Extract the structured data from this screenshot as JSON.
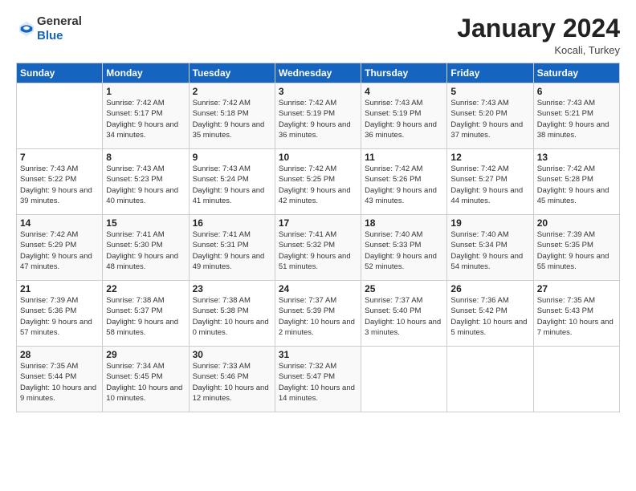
{
  "header": {
    "logo_general": "General",
    "logo_blue": "Blue",
    "month_title": "January 2024",
    "location": "Kocali, Turkey"
  },
  "weekdays": [
    "Sunday",
    "Monday",
    "Tuesday",
    "Wednesday",
    "Thursday",
    "Friday",
    "Saturday"
  ],
  "weeks": [
    [
      {
        "day": "",
        "sunrise": "",
        "sunset": "",
        "daylight": ""
      },
      {
        "day": "1",
        "sunrise": "Sunrise: 7:42 AM",
        "sunset": "Sunset: 5:17 PM",
        "daylight": "Daylight: 9 hours and 34 minutes."
      },
      {
        "day": "2",
        "sunrise": "Sunrise: 7:42 AM",
        "sunset": "Sunset: 5:18 PM",
        "daylight": "Daylight: 9 hours and 35 minutes."
      },
      {
        "day": "3",
        "sunrise": "Sunrise: 7:42 AM",
        "sunset": "Sunset: 5:19 PM",
        "daylight": "Daylight: 9 hours and 36 minutes."
      },
      {
        "day": "4",
        "sunrise": "Sunrise: 7:43 AM",
        "sunset": "Sunset: 5:19 PM",
        "daylight": "Daylight: 9 hours and 36 minutes."
      },
      {
        "day": "5",
        "sunrise": "Sunrise: 7:43 AM",
        "sunset": "Sunset: 5:20 PM",
        "daylight": "Daylight: 9 hours and 37 minutes."
      },
      {
        "day": "6",
        "sunrise": "Sunrise: 7:43 AM",
        "sunset": "Sunset: 5:21 PM",
        "daylight": "Daylight: 9 hours and 38 minutes."
      }
    ],
    [
      {
        "day": "7",
        "sunrise": "Sunrise: 7:43 AM",
        "sunset": "Sunset: 5:22 PM",
        "daylight": "Daylight: 9 hours and 39 minutes."
      },
      {
        "day": "8",
        "sunrise": "Sunrise: 7:43 AM",
        "sunset": "Sunset: 5:23 PM",
        "daylight": "Daylight: 9 hours and 40 minutes."
      },
      {
        "day": "9",
        "sunrise": "Sunrise: 7:43 AM",
        "sunset": "Sunset: 5:24 PM",
        "daylight": "Daylight: 9 hours and 41 minutes."
      },
      {
        "day": "10",
        "sunrise": "Sunrise: 7:42 AM",
        "sunset": "Sunset: 5:25 PM",
        "daylight": "Daylight: 9 hours and 42 minutes."
      },
      {
        "day": "11",
        "sunrise": "Sunrise: 7:42 AM",
        "sunset": "Sunset: 5:26 PM",
        "daylight": "Daylight: 9 hours and 43 minutes."
      },
      {
        "day": "12",
        "sunrise": "Sunrise: 7:42 AM",
        "sunset": "Sunset: 5:27 PM",
        "daylight": "Daylight: 9 hours and 44 minutes."
      },
      {
        "day": "13",
        "sunrise": "Sunrise: 7:42 AM",
        "sunset": "Sunset: 5:28 PM",
        "daylight": "Daylight: 9 hours and 45 minutes."
      }
    ],
    [
      {
        "day": "14",
        "sunrise": "Sunrise: 7:42 AM",
        "sunset": "Sunset: 5:29 PM",
        "daylight": "Daylight: 9 hours and 47 minutes."
      },
      {
        "day": "15",
        "sunrise": "Sunrise: 7:41 AM",
        "sunset": "Sunset: 5:30 PM",
        "daylight": "Daylight: 9 hours and 48 minutes."
      },
      {
        "day": "16",
        "sunrise": "Sunrise: 7:41 AM",
        "sunset": "Sunset: 5:31 PM",
        "daylight": "Daylight: 9 hours and 49 minutes."
      },
      {
        "day": "17",
        "sunrise": "Sunrise: 7:41 AM",
        "sunset": "Sunset: 5:32 PM",
        "daylight": "Daylight: 9 hours and 51 minutes."
      },
      {
        "day": "18",
        "sunrise": "Sunrise: 7:40 AM",
        "sunset": "Sunset: 5:33 PM",
        "daylight": "Daylight: 9 hours and 52 minutes."
      },
      {
        "day": "19",
        "sunrise": "Sunrise: 7:40 AM",
        "sunset": "Sunset: 5:34 PM",
        "daylight": "Daylight: 9 hours and 54 minutes."
      },
      {
        "day": "20",
        "sunrise": "Sunrise: 7:39 AM",
        "sunset": "Sunset: 5:35 PM",
        "daylight": "Daylight: 9 hours and 55 minutes."
      }
    ],
    [
      {
        "day": "21",
        "sunrise": "Sunrise: 7:39 AM",
        "sunset": "Sunset: 5:36 PM",
        "daylight": "Daylight: 9 hours and 57 minutes."
      },
      {
        "day": "22",
        "sunrise": "Sunrise: 7:38 AM",
        "sunset": "Sunset: 5:37 PM",
        "daylight": "Daylight: 9 hours and 58 minutes."
      },
      {
        "day": "23",
        "sunrise": "Sunrise: 7:38 AM",
        "sunset": "Sunset: 5:38 PM",
        "daylight": "Daylight: 10 hours and 0 minutes."
      },
      {
        "day": "24",
        "sunrise": "Sunrise: 7:37 AM",
        "sunset": "Sunset: 5:39 PM",
        "daylight": "Daylight: 10 hours and 2 minutes."
      },
      {
        "day": "25",
        "sunrise": "Sunrise: 7:37 AM",
        "sunset": "Sunset: 5:40 PM",
        "daylight": "Daylight: 10 hours and 3 minutes."
      },
      {
        "day": "26",
        "sunrise": "Sunrise: 7:36 AM",
        "sunset": "Sunset: 5:42 PM",
        "daylight": "Daylight: 10 hours and 5 minutes."
      },
      {
        "day": "27",
        "sunrise": "Sunrise: 7:35 AM",
        "sunset": "Sunset: 5:43 PM",
        "daylight": "Daylight: 10 hours and 7 minutes."
      }
    ],
    [
      {
        "day": "28",
        "sunrise": "Sunrise: 7:35 AM",
        "sunset": "Sunset: 5:44 PM",
        "daylight": "Daylight: 10 hours and 9 minutes."
      },
      {
        "day": "29",
        "sunrise": "Sunrise: 7:34 AM",
        "sunset": "Sunset: 5:45 PM",
        "daylight": "Daylight: 10 hours and 10 minutes."
      },
      {
        "day": "30",
        "sunrise": "Sunrise: 7:33 AM",
        "sunset": "Sunset: 5:46 PM",
        "daylight": "Daylight: 10 hours and 12 minutes."
      },
      {
        "day": "31",
        "sunrise": "Sunrise: 7:32 AM",
        "sunset": "Sunset: 5:47 PM",
        "daylight": "Daylight: 10 hours and 14 minutes."
      },
      {
        "day": "",
        "sunrise": "",
        "sunset": "",
        "daylight": ""
      },
      {
        "day": "",
        "sunrise": "",
        "sunset": "",
        "daylight": ""
      },
      {
        "day": "",
        "sunrise": "",
        "sunset": "",
        "daylight": ""
      }
    ]
  ]
}
